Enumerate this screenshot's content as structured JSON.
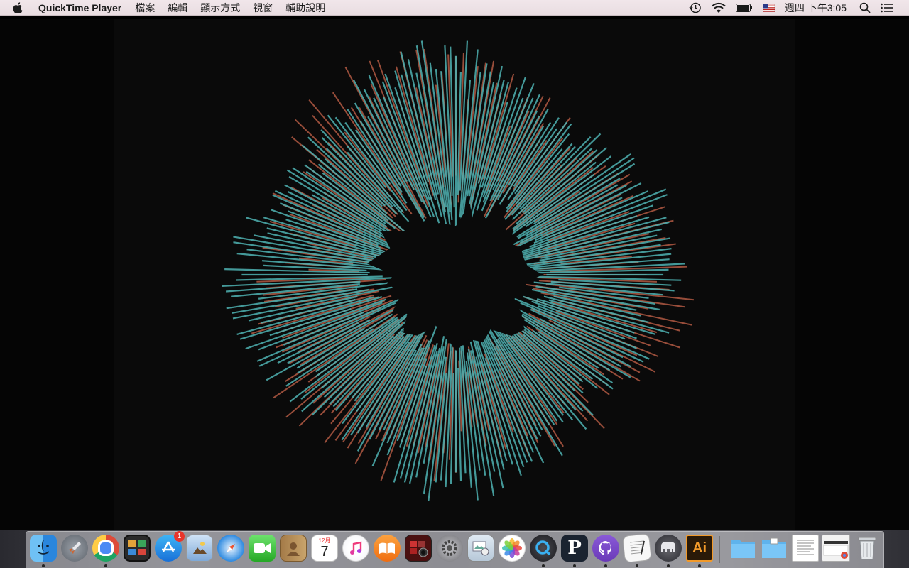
{
  "menubar": {
    "app_name": "QuickTime Player",
    "menus": [
      "檔案",
      "編輯",
      "顯示方式",
      "視窗",
      "輔助說明"
    ],
    "status_icons": [
      "time-machine-icon",
      "wifi-icon",
      "battery-icon",
      "us-flag-input-icon"
    ],
    "clock": "週四 下午3:05",
    "right_icons": [
      "spotlight-icon",
      "notification-center-icon"
    ]
  },
  "video": {
    "visualizer_colors": {
      "primary": "#4fb3b3",
      "secondary": "#c8644a",
      "background": "#0a0a0a"
    }
  },
  "dock": {
    "apps": [
      {
        "name": "finder",
        "icon": "finder-icon",
        "running": true
      },
      {
        "name": "launchpad",
        "icon": "launchpad-icon",
        "running": false
      },
      {
        "name": "chrome",
        "icon": "chrome-icon",
        "running": true
      },
      {
        "name": "photo-booth",
        "icon": "photo-booth-icon",
        "running": false
      },
      {
        "name": "app-store",
        "icon": "app-store-icon",
        "running": false,
        "badge": "1"
      },
      {
        "name": "preview",
        "icon": "preview-icon",
        "running": false
      },
      {
        "name": "safari",
        "icon": "safari-icon",
        "running": false
      },
      {
        "name": "facetime",
        "icon": "facetime-icon",
        "running": false
      },
      {
        "name": "contacts",
        "icon": "contacts-icon",
        "running": false
      },
      {
        "name": "calendar",
        "icon": "calendar-icon",
        "running": false,
        "month": "12月",
        "day": "7"
      },
      {
        "name": "itunes",
        "icon": "itunes-icon",
        "running": false
      },
      {
        "name": "ibooks",
        "icon": "ibooks-icon",
        "running": false
      },
      {
        "name": "photo-booth-2",
        "icon": "photo-booth-camera-icon",
        "running": false
      },
      {
        "name": "system-preferences",
        "icon": "system-preferences-icon",
        "running": false
      },
      {
        "name": "mail-preview",
        "icon": "image-capture-icon",
        "running": false
      },
      {
        "name": "photos",
        "icon": "photos-icon",
        "running": false
      },
      {
        "name": "quicktime",
        "icon": "quicktime-icon",
        "running": true
      },
      {
        "name": "p-app",
        "icon": "p-app-icon",
        "running": true,
        "letter": "P"
      },
      {
        "name": "github",
        "icon": "github-icon",
        "running": true
      },
      {
        "name": "textedit",
        "icon": "textedit-icon",
        "running": true
      },
      {
        "name": "sequel-pro",
        "icon": "elephant-icon",
        "running": true
      },
      {
        "name": "illustrator",
        "icon": "illustrator-icon",
        "running": true,
        "letter": "Ai"
      }
    ],
    "stacks": [
      {
        "name": "folder-1",
        "icon": "folder-icon"
      },
      {
        "name": "folder-2",
        "icon": "folder-icon"
      },
      {
        "name": "document-stack",
        "icon": "document-icon"
      },
      {
        "name": "chrome-window",
        "icon": "chrome-window-icon"
      },
      {
        "name": "trash",
        "icon": "trash-icon"
      }
    ]
  }
}
